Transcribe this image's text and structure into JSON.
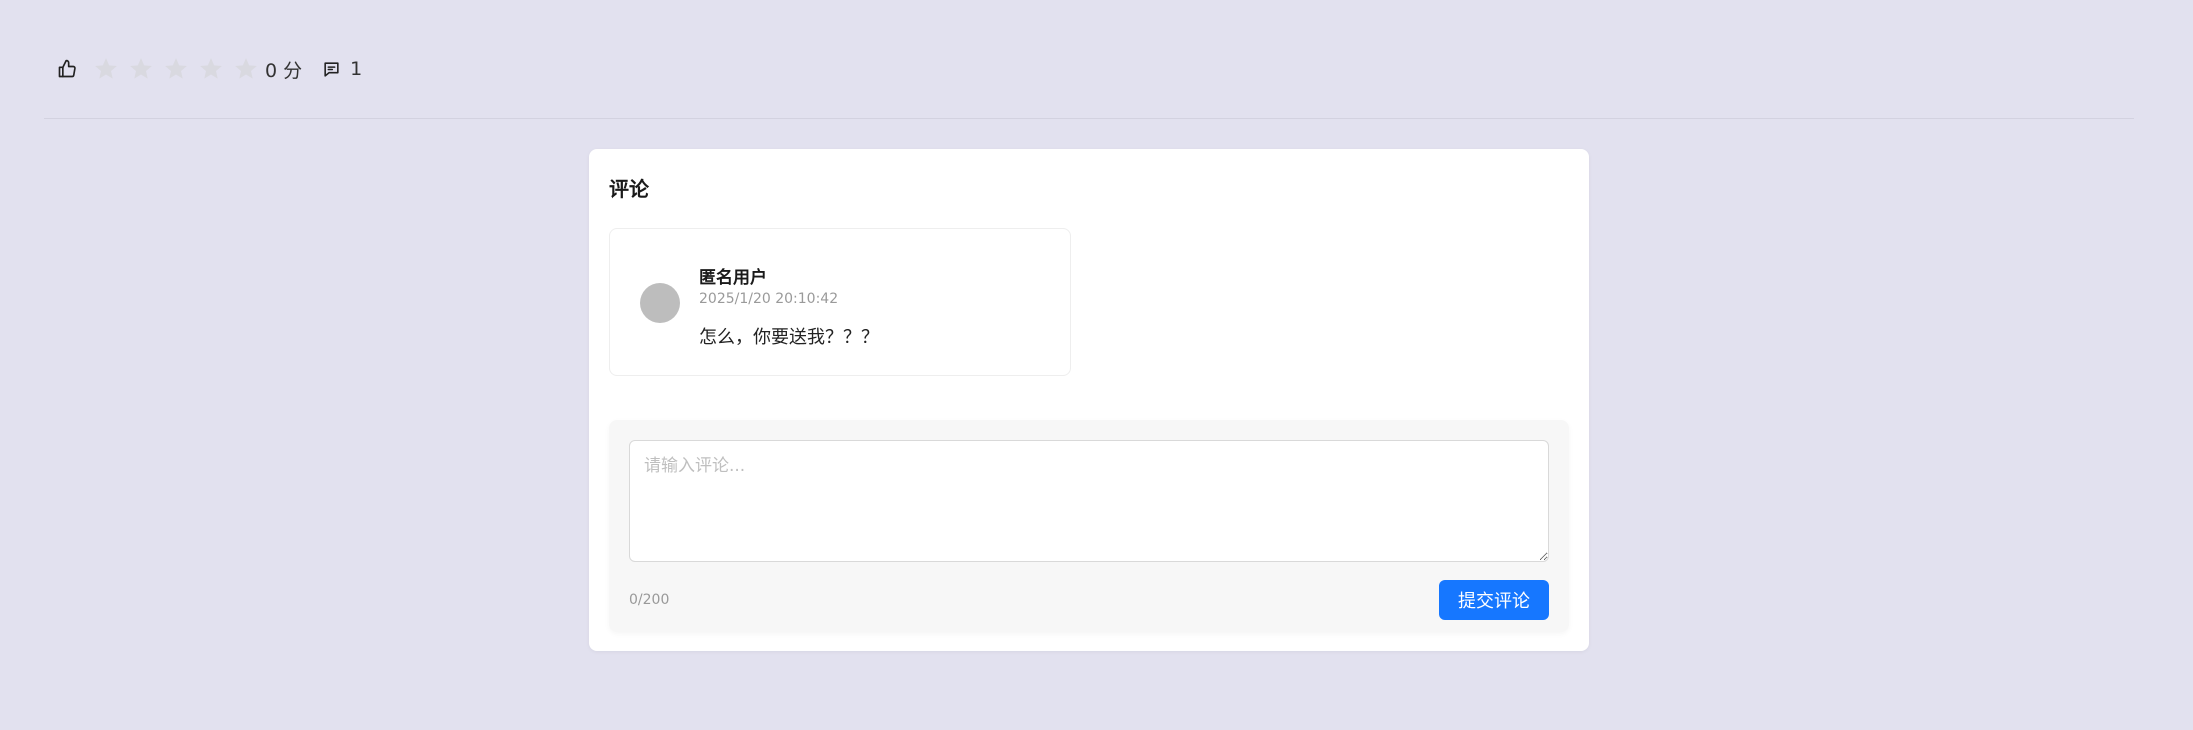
{
  "rating": {
    "like_icon": "thumbs-up-icon",
    "stars_total": 5,
    "stars_filled": 0,
    "star_icon": "star-icon",
    "star_color": "#d9d9e0",
    "score_text": "0 分",
    "comment_icon": "comment-bubble-icon",
    "comment_count": "1"
  },
  "comments_section": {
    "title": "评论",
    "items": [
      {
        "user": "匿名用户",
        "time": "2025/1/20 20:10:42",
        "text": "怎么，你要送我？？？",
        "avatar_color": "#bdbdbd"
      }
    ],
    "compose": {
      "placeholder": "请输入评论...",
      "value": "",
      "char_count": "0/200",
      "submit_label": "提交评论",
      "submit_color": "#1677ff"
    }
  }
}
